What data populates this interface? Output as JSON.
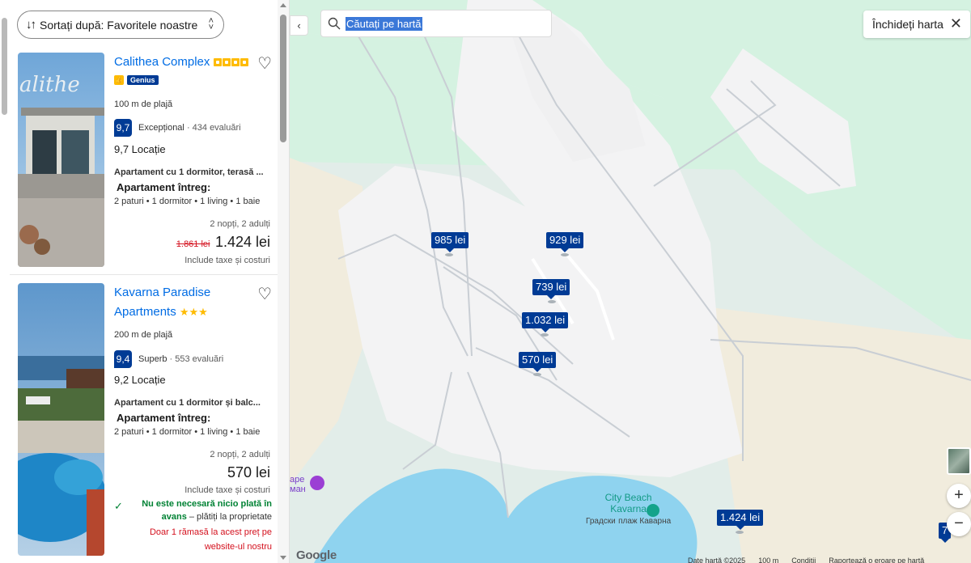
{
  "sort": {
    "label": "Sortați după: Favoritele noastre"
  },
  "listings": [
    {
      "name": "Calithea Complex",
      "stars": 4,
      "genius": "Genius",
      "distance": "100 m de plajă",
      "score": "9,7",
      "score_word": "Excepțional",
      "reviews": "· 434 evaluări",
      "location_score": "9,7 Locație",
      "apartment_desc": "Apartament cu 1 dormitor, terasă ...",
      "unit_type": "Apartament întreg:",
      "beds": "2 paturi • 1 dormitor • 1 living • 1 baie",
      "stay": "2 nopți, 2 adulți",
      "old_price": "1.861 lei",
      "price": "1.424 lei",
      "taxes": "Include taxe și costuri"
    },
    {
      "name_line1": "Kavarna Paradise",
      "name_line2": "Apartments",
      "stars": 3,
      "distance": "200 m de plajă",
      "score": "9,4",
      "score_word": "Superb",
      "reviews": "· 553 evaluări",
      "location_score": "9,2 Locație",
      "apartment_desc": "Apartament cu 1 dormitor și balc...",
      "unit_type": "Apartament întreg:",
      "beds": "2 paturi • 1 dormitor • 1 living • 1 baie",
      "stay": "2 nopți, 2 adulți",
      "price": "570 lei",
      "taxes": "Include taxe și costuri",
      "no_prepay_bold": "Nu este necesară nicio plată în avans",
      "no_prepay_rest": " – plătiți la proprietate",
      "only_left": "Doar 1 rămasă la acest preț pe website-ul nostru"
    }
  ],
  "map": {
    "search_placeholder": "Căutați pe hartă",
    "close_label": "Închideți harta",
    "pins": [
      {
        "label": "985 lei"
      },
      {
        "label": "929 lei"
      },
      {
        "label": "739 lei"
      },
      {
        "label": "1.032 lei"
      },
      {
        "label": "570 lei"
      },
      {
        "label": "1.424 lei"
      },
      {
        "label": "7"
      }
    ],
    "poi": {
      "name_line1": "City Beach",
      "name_line2": "Kavarna",
      "local_line1": "Градски",
      "local_line2": "плаж Каварна"
    },
    "cafe": {
      "line1": "ape",
      "line2": "ман"
    },
    "google": "Google",
    "attribution": [
      "Date hartă ©2025",
      "100 m",
      "Condiții",
      "Raportează o eroare pe hartă"
    ],
    "zoom_in": "+",
    "zoom_out": "−"
  },
  "colors": {
    "brand_blue": "#003b95",
    "link_blue": "#006ce4",
    "star_yellow": "#febb02",
    "green": "#008234",
    "red": "#d4111e"
  },
  "icons": [
    "sort-icon",
    "chevron-updown-icon",
    "heart-icon",
    "search-icon",
    "close-icon",
    "check-icon",
    "chevron-left-icon"
  ]
}
